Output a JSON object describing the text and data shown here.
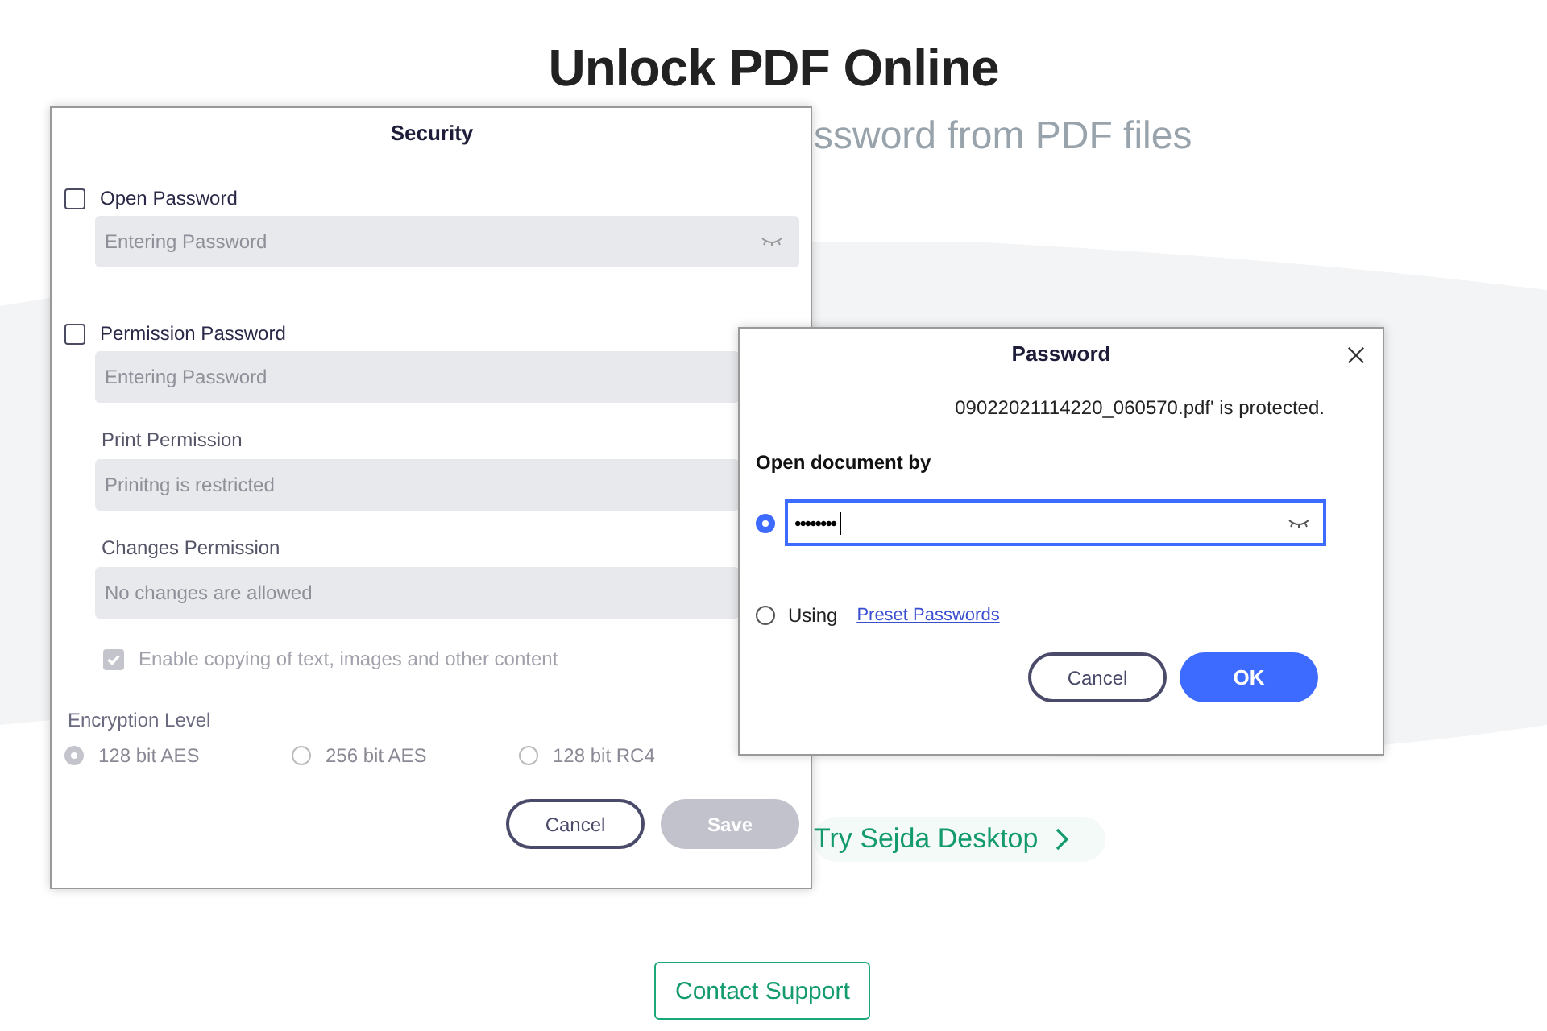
{
  "page": {
    "title": "Unlock PDF Online",
    "subtitle": "ssword from PDF files",
    "desktop_link": "Try Sejda Desktop",
    "support_button": "Contact Support"
  },
  "security_dialog": {
    "title": "Security",
    "open_password": {
      "label": "Open Password",
      "checked": false,
      "placeholder": "Entering Password"
    },
    "permission_password": {
      "label": "Permission Password",
      "checked": false,
      "placeholder": "Entering Password"
    },
    "print_permission": {
      "label": "Print Permission",
      "value": "Prinitng is restricted"
    },
    "changes_permission": {
      "label": "Changes Permission",
      "value": "No changes are allowed"
    },
    "copy_option": {
      "label": "Enable copying of text, images and other content",
      "checked": true,
      "disabled": true
    },
    "encryption": {
      "label": "Encryption Level",
      "options": [
        {
          "label": "128 bit AES",
          "selected": true
        },
        {
          "label": "256 bit AES",
          "selected": false
        },
        {
          "label": "128 bit RC4",
          "selected": false
        }
      ]
    },
    "buttons": [
      {
        "label": "Cancel",
        "kind": "secondary"
      },
      {
        "label": "Save",
        "kind": "disabled"
      }
    ]
  },
  "password_dialog": {
    "title": "Password",
    "message": "09022021114220_060570.pdf' is protected.",
    "heading": "Open document by",
    "options": [
      {
        "kind": "password",
        "selected": true,
        "value": "••••••••"
      },
      {
        "kind": "preset",
        "selected": false,
        "label": "Using",
        "link": "Preset Passwords"
      }
    ],
    "buttons": [
      {
        "label": "Cancel",
        "kind": "secondary"
      },
      {
        "label": "OK",
        "kind": "primary"
      }
    ]
  }
}
